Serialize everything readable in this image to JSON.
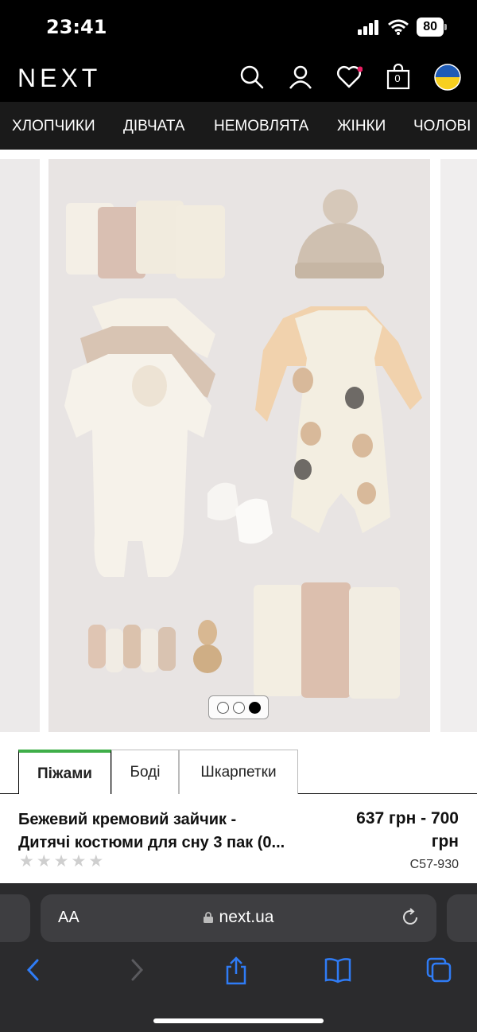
{
  "status": {
    "time": "23:41",
    "battery": "80"
  },
  "header": {
    "logo": "NEXT",
    "cart_count": "0"
  },
  "nav": {
    "items": [
      "ХЛОПЧИКИ",
      "ДІВЧАТА",
      "НЕМОВЛЯТА",
      "ЖІНКИ",
      "ЧОЛОВІ"
    ]
  },
  "gallery": {
    "image_count": 3,
    "active_index": 3
  },
  "tabs": [
    "Піжами",
    "Боді",
    "Шкарпетки"
  ],
  "product": {
    "title_line1": "Бежевий кремовий зайчик -",
    "title_line2": "Дитячі костюми для сну 3 пак (0...",
    "price_line1": "637 грн - 700",
    "price_line2": "грн",
    "code": "C57-930",
    "rating": 0
  },
  "browser": {
    "text_size": "AA",
    "url": "next.ua"
  },
  "colors": {
    "accent": "#3fae49",
    "header_bg": "#000000",
    "nav_bg": "#1a1a1a",
    "wishlist_dot": "#e91e63"
  }
}
